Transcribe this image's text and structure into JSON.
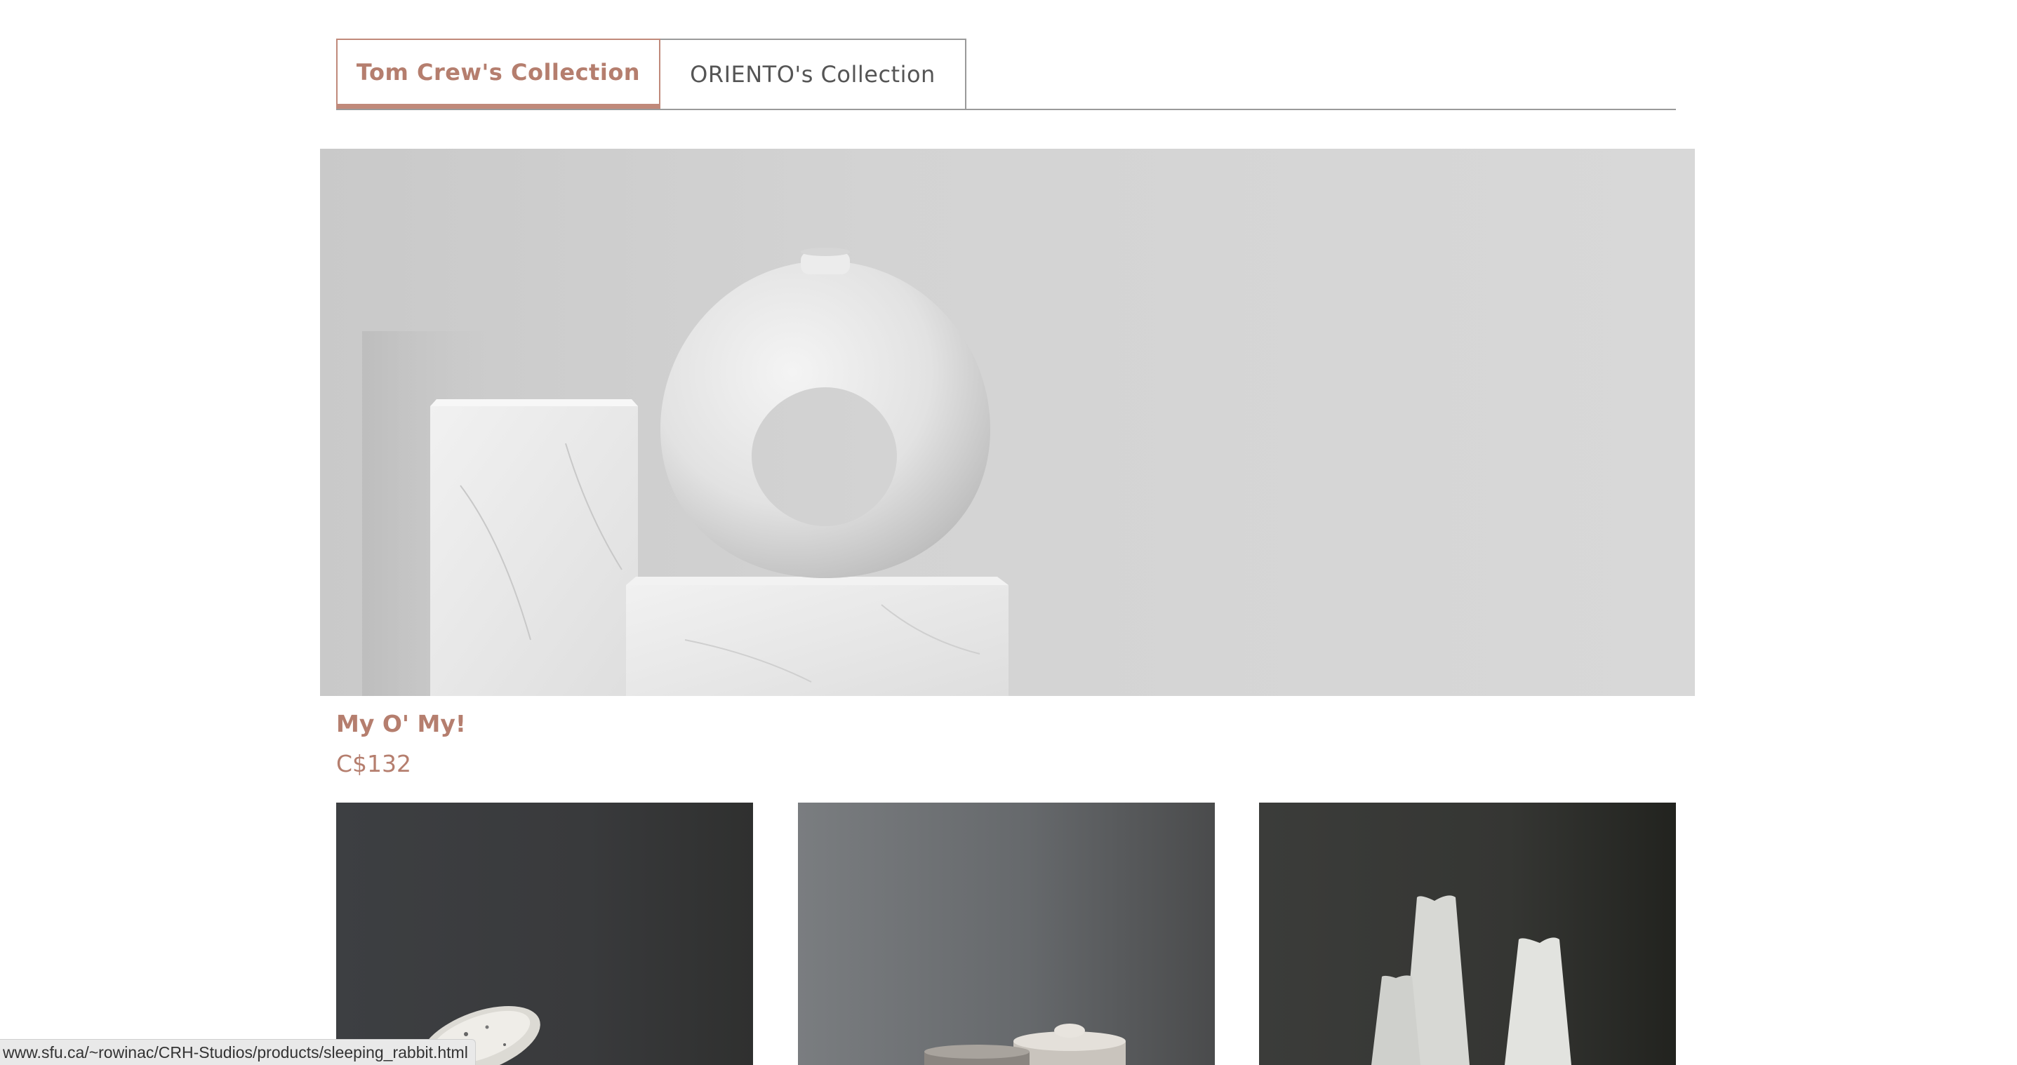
{
  "tabs": [
    {
      "label": "Tom Crew's Collection",
      "active": true
    },
    {
      "label": "ORIENTO's Collection",
      "active": false
    }
  ],
  "featured": {
    "title": "My O' My!",
    "price": "C$132"
  },
  "status_bar": {
    "url": "www.sfu.ca/~rowinac/CRH-Studios/products/sleeping_rabbit.html"
  },
  "colors": {
    "accent": "#b57e6e",
    "tab_border": "#c0897a",
    "divider": "#9a9a9a"
  }
}
